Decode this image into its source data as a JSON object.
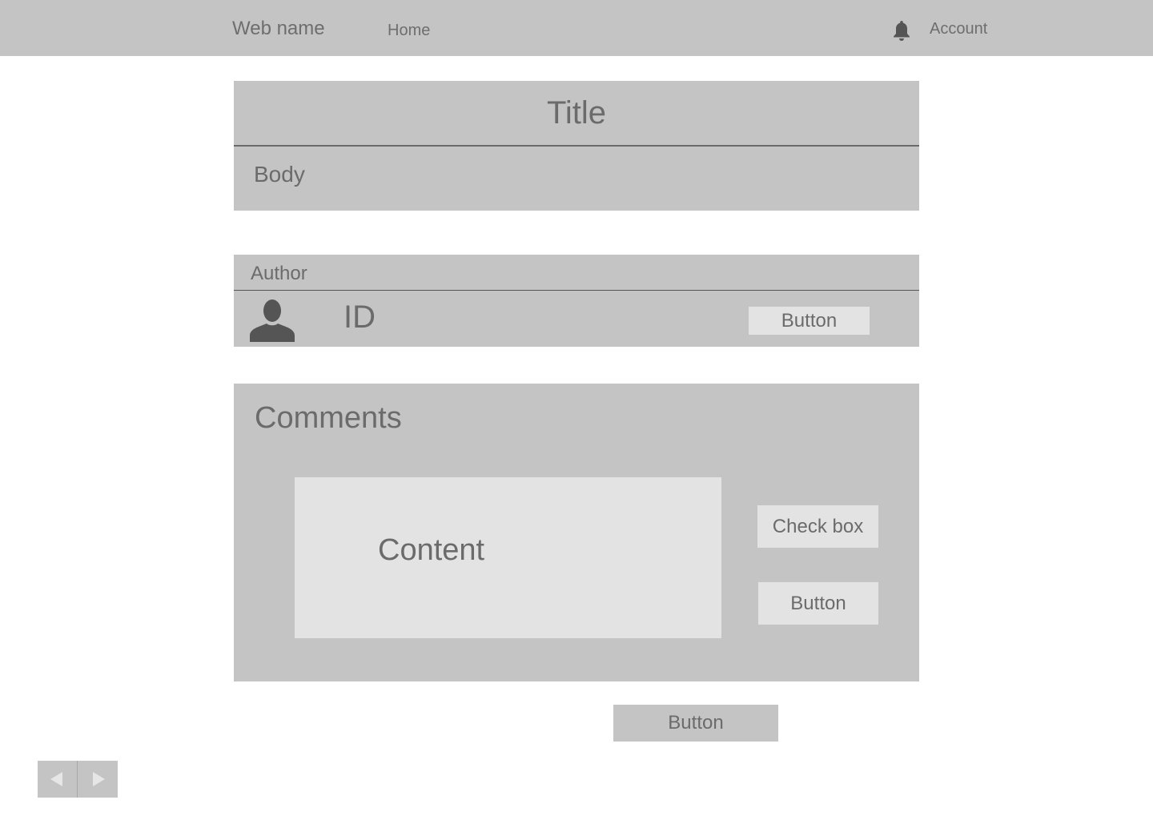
{
  "header": {
    "brand": "Web name",
    "nav_home": "Home",
    "notification_icon": "bell-icon",
    "account": "Account"
  },
  "post": {
    "title": "Title",
    "body": "Body"
  },
  "author": {
    "label": "Author",
    "avatar_icon": "user-silhouette-icon",
    "id": "ID",
    "button_label": "Button"
  },
  "comments": {
    "title": "Comments",
    "content": "Content",
    "checkbox_label": "Check box",
    "button_label": "Button"
  },
  "footer": {
    "button_label": "Button",
    "prev_icon": "arrow-left-icon",
    "next_icon": "arrow-right-icon"
  },
  "colors": {
    "panel": "#c4c4c4",
    "light_panel": "#e3e3e3",
    "text": "#6b6b6b",
    "icon": "#555555",
    "background": "#ffffff"
  }
}
